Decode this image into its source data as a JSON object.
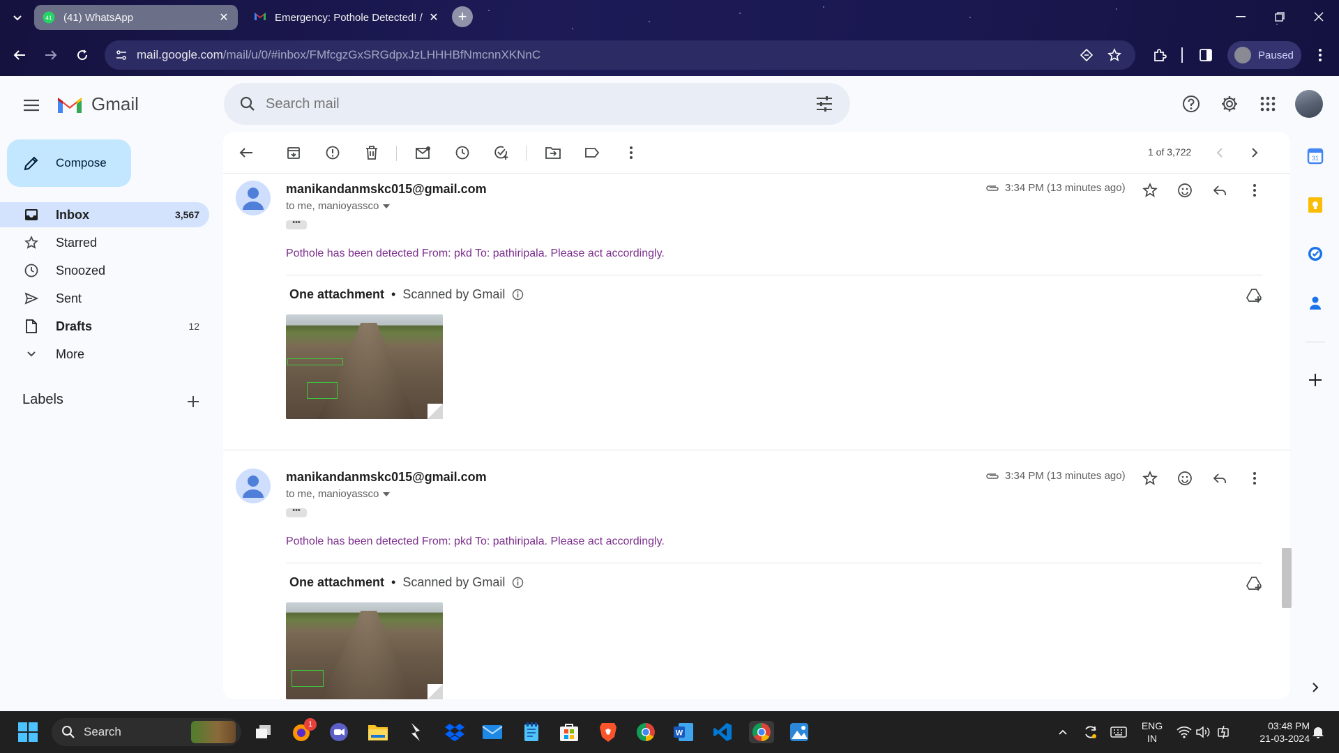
{
  "browser": {
    "tabs": [
      {
        "title": "(41) WhatsApp",
        "badge": "41",
        "active": true
      },
      {
        "title": "Emergency: Pothole Detected! / ...",
        "active": false
      }
    ],
    "url_host": "mail.google.com",
    "url_path": "/mail/u/0/#inbox/FMfcgzGxSRGdpxJzLHHHBfNmcnnXKNnC",
    "profile_status": "Paused"
  },
  "gmail": {
    "brand": "Gmail",
    "search_placeholder": "Search mail",
    "compose_label": "Compose",
    "nav": [
      {
        "label": "Inbox",
        "count": "3,567",
        "icon": "inbox-icon",
        "selected": true
      },
      {
        "label": "Starred",
        "count": "",
        "icon": "star-icon"
      },
      {
        "label": "Snoozed",
        "count": "",
        "icon": "clock-icon"
      },
      {
        "label": "Sent",
        "count": "",
        "icon": "send-icon"
      },
      {
        "label": "Drafts",
        "count": "12",
        "icon": "draft-icon"
      },
      {
        "label": "More",
        "count": "",
        "icon": "chevron-down-icon"
      }
    ],
    "labels_heading": "Labels",
    "pager": "1 of 3,722",
    "messages": [
      {
        "sender": "manikandanmskc015@gmail.com",
        "to": "to me, manioyassco",
        "time": "3:34 PM (13 minutes ago)",
        "body": "Pothole has been detected From: pkd To: pathiripala. Please act accordingly.",
        "attachment_heading": "One attachment",
        "scanned": "Scanned by Gmail"
      },
      {
        "sender": "manikandanmskc015@gmail.com",
        "to": "to me, manioyassco",
        "time": "3:34 PM (13 minutes ago)",
        "body": "Pothole has been detected From: pkd To: pathiripala. Please act accordingly.",
        "attachment_heading": "One attachment",
        "scanned": "Scanned by Gmail"
      }
    ]
  },
  "taskbar": {
    "search_label": "Search",
    "notification_badge": "1",
    "language": "ENG",
    "region": "IN",
    "time": "03:48 PM",
    "date": "21-03-2024"
  },
  "colors": {
    "accent": "#0b57d0",
    "selected_nav": "#d3e3fd",
    "compose_bg": "#c2e7ff",
    "body_text": "#7b2e8c"
  }
}
